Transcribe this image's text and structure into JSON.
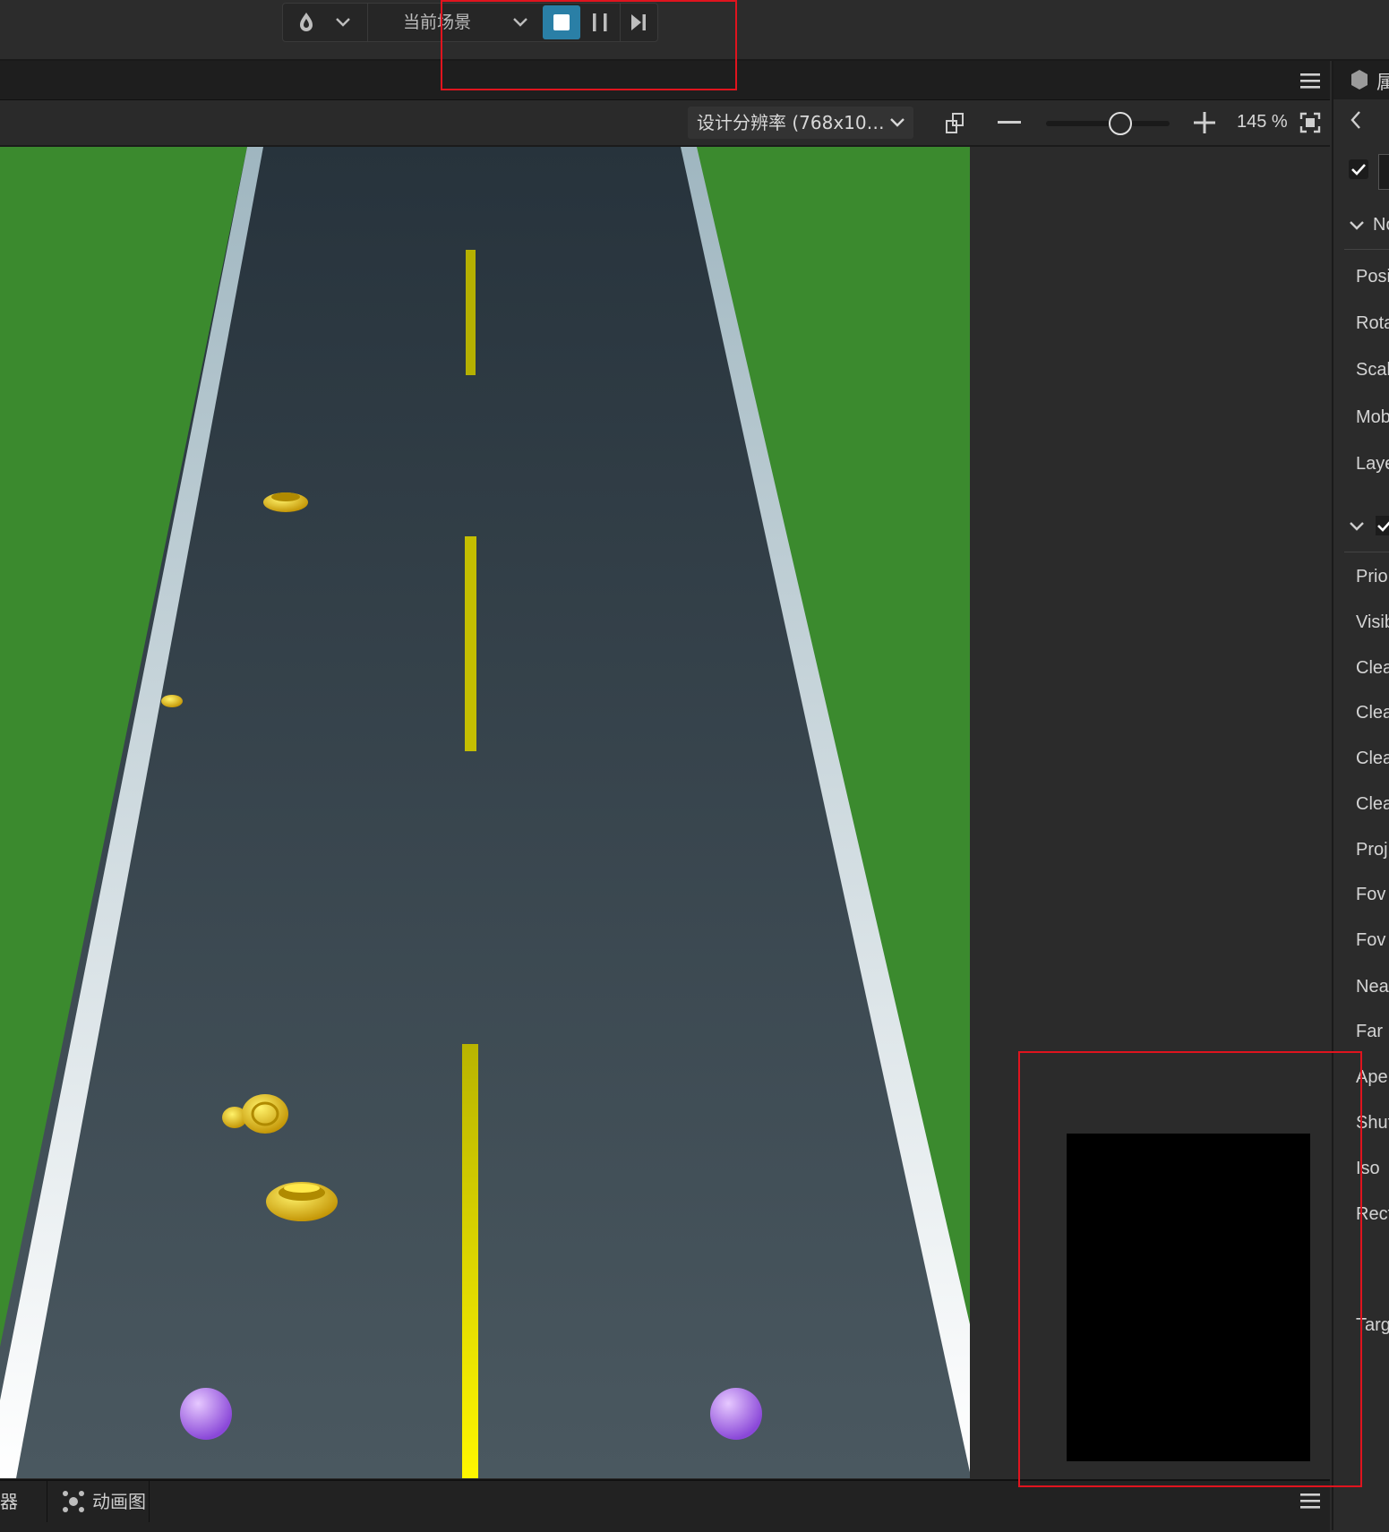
{
  "toolbar": {
    "scene_select_label": "当前场景",
    "buttons": [
      "build-icon",
      "dropdown-icon",
      "stop-icon",
      "pause-icon",
      "step-icon"
    ]
  },
  "viewport_toolbar": {
    "resolution_label": "设计分辨率 (768x10…",
    "zoom_value": "145 %",
    "zoom_slider_fraction": 0.6
  },
  "bottom_bar": {
    "prev_tab_label": "器",
    "anim_tab_label": "动画图"
  },
  "inspector": {
    "title_fragment": "属",
    "section_node": "No",
    "node_props": [
      "Posi",
      "Rota",
      "Scal",
      "Mob",
      "Laye"
    ],
    "camera_props": [
      "Prior",
      "Visib",
      "Clea",
      "Clea",
      "Clea",
      "Clea",
      "Proj",
      "Fov",
      "Fov",
      "Nea",
      "Far",
      "Aper",
      "Shut",
      "Iso",
      "Rect",
      "Targ"
    ]
  },
  "colors": {
    "accent": "#2a7fa6",
    "grass": "#3b8a2e",
    "road": "#2e3a44",
    "lane_marker": "#e8e800",
    "annotation": "#e0141e"
  }
}
